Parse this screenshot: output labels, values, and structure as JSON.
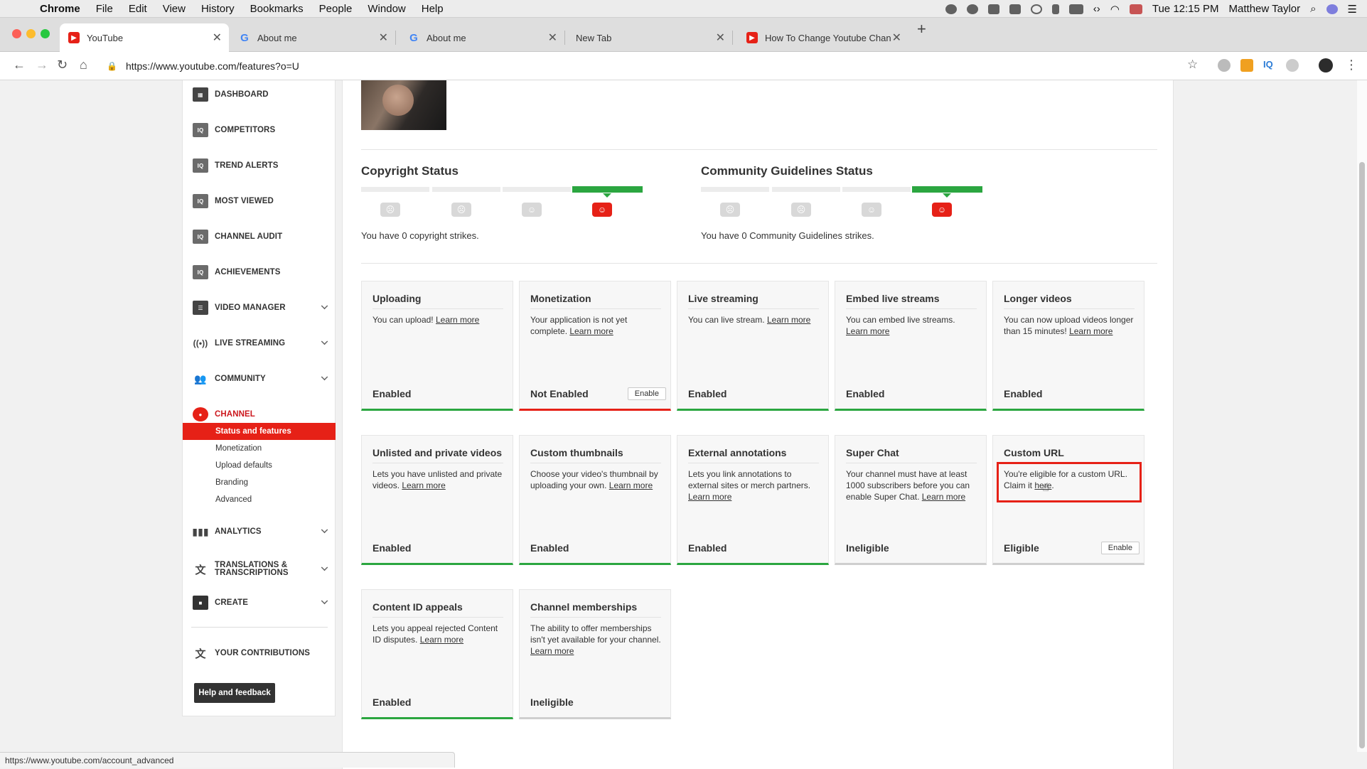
{
  "menubar": {
    "app_name": "Chrome",
    "items": [
      "File",
      "Edit",
      "View",
      "History",
      "Bookmarks",
      "People",
      "Window",
      "Help"
    ],
    "clock": "Tue 12:15 PM",
    "user": "Matthew Taylor"
  },
  "tabs": [
    {
      "title": "YouTube",
      "favicon": "youtube-icon",
      "active": true
    },
    {
      "title": "About me",
      "favicon": "google-icon",
      "active": false
    },
    {
      "title": "About me",
      "favicon": "google-icon",
      "active": false
    },
    {
      "title": "New Tab",
      "favicon": "",
      "active": false
    },
    {
      "title": "How To Change Youtube Chan",
      "favicon": "youtube-icon",
      "active": false
    }
  ],
  "address": {
    "url": "https://www.youtube.com/features?o=U"
  },
  "sidebar": {
    "items": [
      {
        "label": "DASHBOARD",
        "icon": "dashboard-icon"
      },
      {
        "label": "COMPETITORS",
        "icon": "vidiq-icon"
      },
      {
        "label": "TREND ALERTS",
        "icon": "vidiq-icon"
      },
      {
        "label": "MOST VIEWED",
        "icon": "vidiq-icon"
      },
      {
        "label": "CHANNEL AUDIT",
        "icon": "vidiq-icon"
      },
      {
        "label": "ACHIEVEMENTS",
        "icon": "vidiq-icon"
      },
      {
        "label": "VIDEO MANAGER",
        "icon": "video-manager-icon"
      },
      {
        "label": "LIVE STREAMING",
        "icon": "live-icon"
      },
      {
        "label": "COMMUNITY",
        "icon": "community-icon"
      },
      {
        "label": "CHANNEL",
        "icon": "channel-icon"
      }
    ],
    "channel_sub": [
      "Status and features",
      "Monetization",
      "Upload defaults",
      "Branding",
      "Advanced"
    ],
    "lower_items": [
      {
        "label": "ANALYTICS",
        "icon": "analytics-icon"
      },
      {
        "label": "TRANSLATIONS &",
        "label2": "TRANSCRIPTIONS",
        "icon": "translate-icon"
      },
      {
        "label": "CREATE",
        "icon": "create-icon"
      }
    ],
    "contributions": "YOUR CONTRIBUTIONS",
    "help_button": "Help and feedback"
  },
  "status": {
    "copyright_title": "Copyright Status",
    "copyright_text": "You have 0 copyright strikes.",
    "community_title": "Community Guidelines Status",
    "community_text": "You have 0 Community Guidelines strikes."
  },
  "cards": [
    {
      "title": "Uploading",
      "desc": "You can upload!",
      "link": "Learn more",
      "status": "Enabled",
      "state": "green"
    },
    {
      "title": "Monetization",
      "desc": "Your application is not yet complete.",
      "link": "Learn more",
      "status": "Not Enabled",
      "state": "red",
      "button": "Enable"
    },
    {
      "title": "Live streaming",
      "desc": "You can live stream.",
      "link": "Learn more",
      "status": "Enabled",
      "state": "green"
    },
    {
      "title": "Embed live streams",
      "desc": "You can embed live streams.",
      "link": "Learn more",
      "status": "Enabled",
      "state": "green"
    },
    {
      "title": "Longer videos",
      "desc": "You can now upload videos longer than 15 minutes!",
      "link": "Learn more",
      "status": "Enabled",
      "state": "green"
    },
    {
      "title": "Unlisted and private videos",
      "desc": "Lets you have unlisted and private videos.",
      "link": "Learn more",
      "status": "Enabled",
      "state": "green"
    },
    {
      "title": "Custom thumbnails",
      "desc": "Choose your video's thumbnail by uploading your own.",
      "link": "Learn more",
      "status": "Enabled",
      "state": "green"
    },
    {
      "title": "External annotations",
      "desc": "Lets you link annotations to external sites or merch partners.",
      "link": "Learn more",
      "status": "Enabled",
      "state": "green"
    },
    {
      "title": "Super Chat",
      "desc": "Your channel must have at least 1000 subscribers before you can enable Super Chat.",
      "link": "Learn more",
      "status": "Ineligible",
      "state": "gray"
    },
    {
      "title": "Custom URL",
      "desc": "You're eligible for a custom URL. Claim it",
      "link": "here",
      "suffix": ".",
      "status": "Eligible",
      "state": "gray",
      "button": "Enable"
    },
    {
      "title": "Content ID appeals",
      "desc": "Lets you appeal rejected Content ID disputes.",
      "link": "Learn more",
      "status": "Enabled",
      "state": "green"
    },
    {
      "title": "Channel memberships",
      "desc": "The ability to offer memberships isn't yet available for your channel.",
      "link": "Learn more",
      "status": "Ineligible",
      "state": "gray"
    }
  ],
  "statusbar": {
    "url": "https://www.youtube.com/account_advanced"
  },
  "colors": {
    "accent_red": "#e62117",
    "enabled_green": "#2ba640"
  }
}
